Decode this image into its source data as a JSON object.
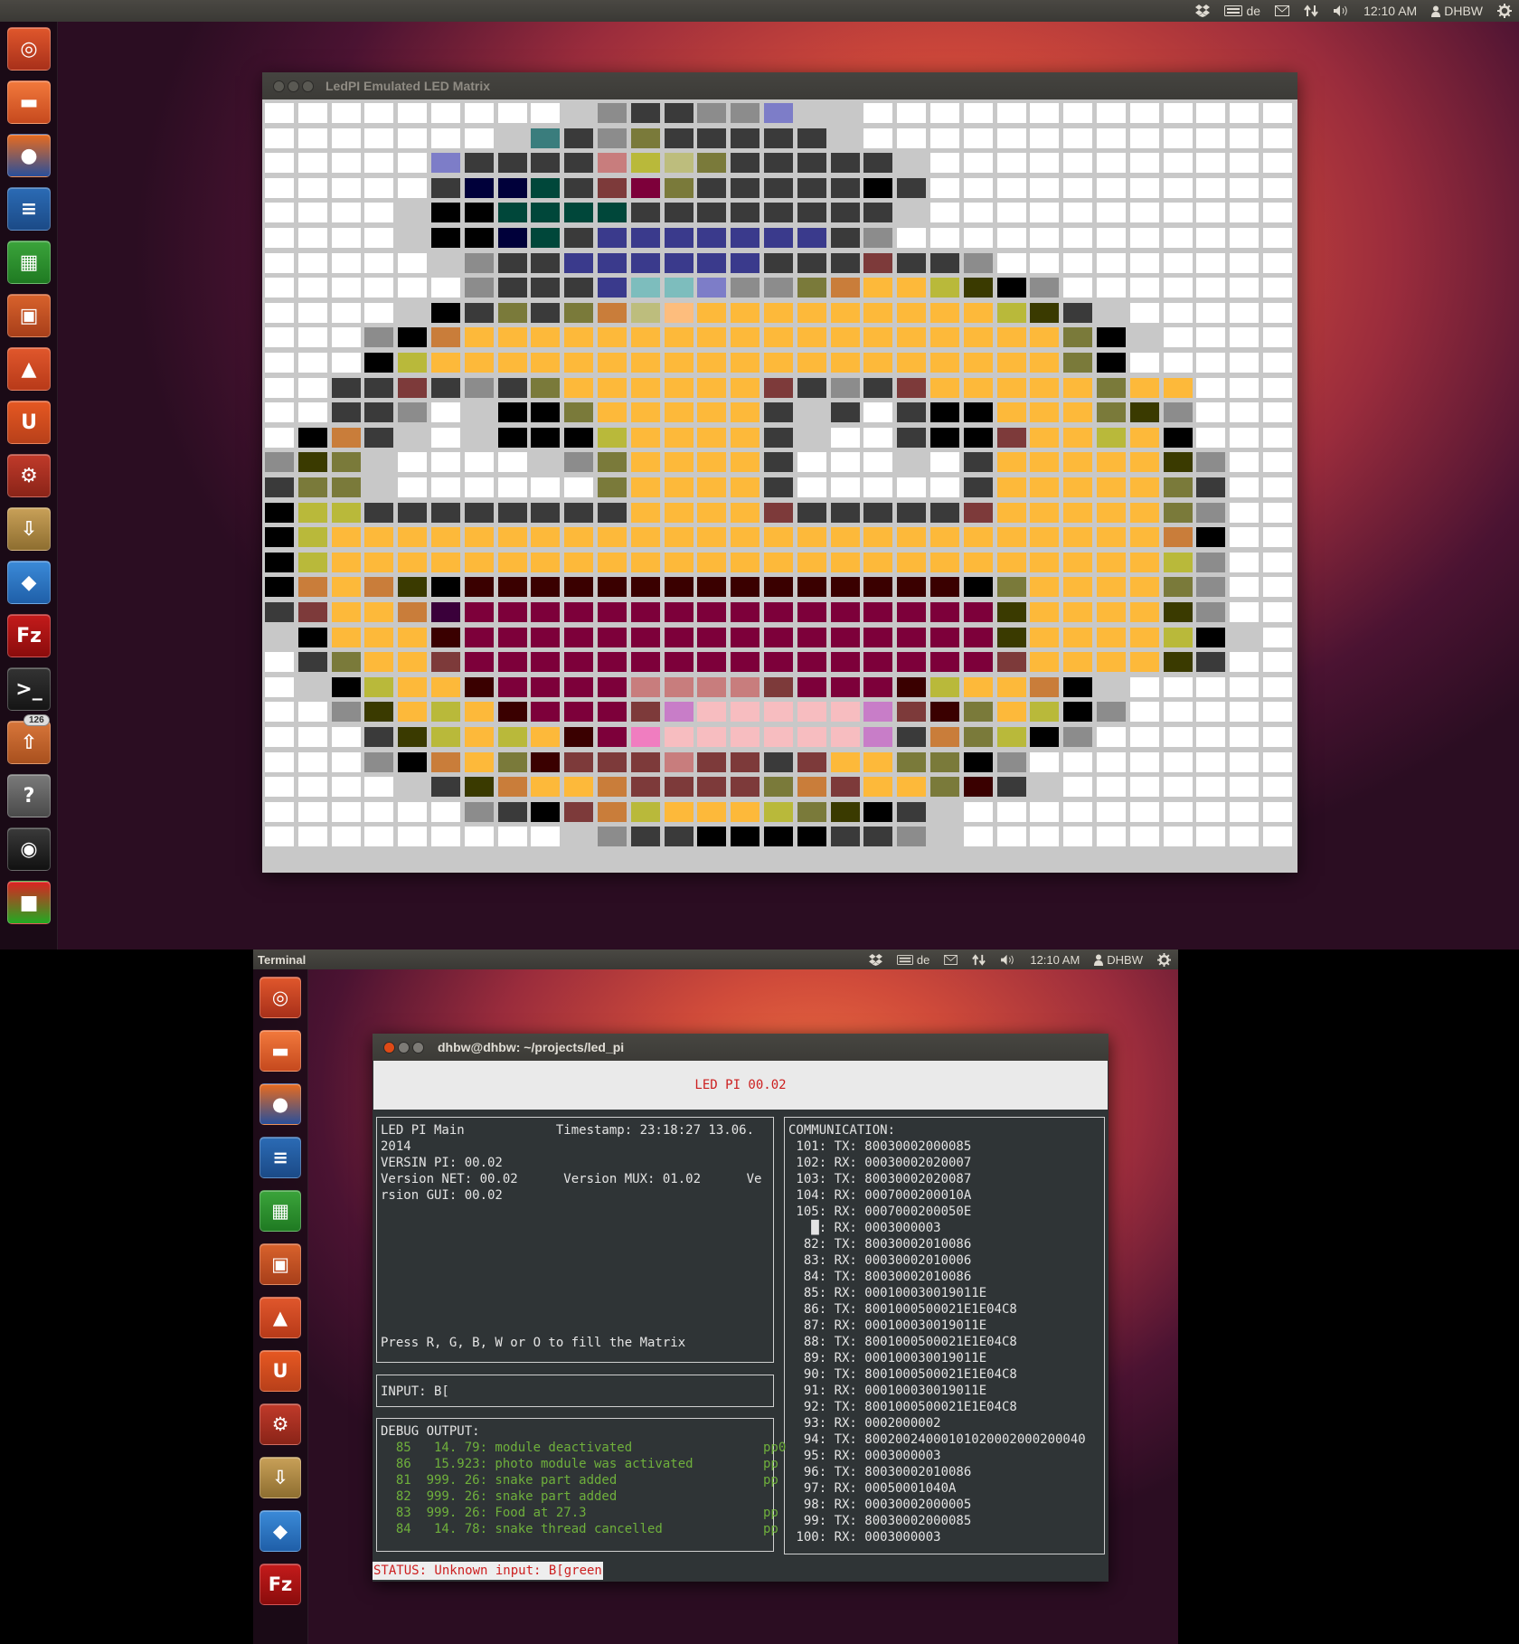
{
  "top_panel": {
    "keyboard_layout": "de",
    "clock": "12:10 AM",
    "user": "DHBW"
  },
  "second_panel": {
    "app_title": "Terminal",
    "keyboard_layout": "de",
    "clock": "12:10 AM",
    "user": "DHBW"
  },
  "launcher": {
    "items": [
      "ubuntu-home",
      "files",
      "firefox",
      "writer",
      "calc",
      "impress",
      "software-center",
      "ubuntu-one",
      "system-settings",
      "update-manager",
      "dropbox",
      "filezilla",
      "terminal",
      "archive-manager",
      "help",
      "webcam",
      "workspaces",
      "trash"
    ],
    "badge_count": "126"
  },
  "led_window": {
    "title": "LedPI Emulated LED Matrix",
    "palette": {
      "W": "#ffffff",
      "L": "#c8c8c8",
      "G": "#8c8c8c",
      "D": "#3a3a3a",
      "K": "#000000",
      "Y": "#fdb93a",
      "O": "#c97d3a",
      "V": "#7a7a3a",
      "A": "#b9b93a",
      "Q": "#3a3a00",
      "N": "#00003a",
      "B": "#3a3a8c",
      "P": "#7d7dc8",
      "T": "#00473a",
      "C": "#3a7d7d",
      "S": "#7dbdbd",
      "M": "#7d003a",
      "R": "#3a0000",
      "X": "#7d3a3a",
      "H": "#c87d7d",
      "F": "#f7bdc0",
      "I": "#c87dc8",
      "J": "#f07dc0",
      "E": "#bdbd7d",
      "U": "#3a003a",
      "Z": "#fdbd7d",
      "k": "#7d3a7d"
    },
    "rows": [
      "WWWWWWWWWLGDDGGPLLWWWWWWWWWWWWW",
      "WWWWWWWLCDGVDDDDDLWWWWWWWWWWWWW",
      "WWWWWPDDDDHAEVDDDDDLWWWWWWWWWWW",
      "WWWWWDNNTDXMVDDDDDKDWWWWWWWWWWW",
      "WWWWLKKTTTTDDDDDDDDLWWWWWWWWWWW",
      "WWWWLKKNTDBBBBBBBDGWWWWWWWWWWWW",
      "WWWWWLGDDBBBBBBDDDXDDGWWWWWWWWW",
      "WWWWWWGDDDBSSPGGVOYYAQKGWWWWWWW",
      "WWWWLKDVDVOEZYYYYYYYYYAQDLWWWWW",
      "WWWGKOYYYYYYYYYYYYYYYYYYVKLWWWW",
      "WWWKAYYYYYYYYYYYYYYYYYYYVKWWWWW",
      "WWDDXDGDVYYYYYYXDGDXYYYYYVYYWWW",
      "WWDDGWLKKVYYYYYDLDWDKKYYYVQGWWW",
      "WKODLWLKKKAYYYYDLWWDKKXYYAYKWWW",
      "GQVLWWWWLGVYYYYDWWWLWDYYYYYQGWW",
      "DVVLWWWWWWVYYYYDWWWWWDYYYYYVDWW",
      "KAADDDDDDDDYYYYXDDDDDXYYYYYVGWW",
      "KAYYYYYYYYYYYYYYYYYYYYYYYYYOKWW",
      "KAYYYYYYYYYYYYYYYYYYYYYYYYYAGWW",
      "KOYOQKRRRRRRRRRRRRRRRKVYYYYVGWW",
      "DXYYOUMMMMMMMMMMMMMMMMQYYYYQGWW",
      "LKYYYRMMMMMMMMMMMMMMMMQYYYYAKLW",
      "WDVYYXMMMMMMMMMMMMMMMMXYYYYQDWW",
      "WLKAYYRMMMMHHHHXMMMRAYYOKLWWWWW",
      "WWGQYAYRMMMXIFFFFFIXRVYAKGWWWWW",
      "WWWDQAYAYRMJFFFFFFIDOVAKGWWWWWW",
      "WWWGKOYVRXXXHXXDXYYVVKGWWWWWWWW",
      "WWWWLDQOYYOXXXXVOXYYVRDLWWWWWWW",
      "WWWWWWGDKXOAYYYAVQKDLWWWWWWWWWW",
      "WWWWWWWWWLGDDKKKKDDGLWWWWWWWWWW"
    ]
  },
  "terminal": {
    "title": "dhbw@dhbw: ~/projects/led_pi",
    "header": "LED PI 00.02",
    "main_lines": [
      "LED PI Main            Timestamp: 23:18:27 13.06.",
      "2014",
      "VERSIN PI: 00.02",
      "Version NET: 00.02      Version MUX: 01.02      Ve",
      "rsion GUI: 00.02"
    ],
    "prompt_text": "Press R, G, B, W or O to fill the Matrix",
    "input_label": "INPUT: B[",
    "debug_title": "DEBUG OUTPUT:",
    "debug_lines": [
      "  85   14. 79: module deactivated",
      "  86   15.923: photo module was activated",
      "  81  999. 26: snake part added",
      "  82  999. 26: snake part added",
      "  83  999. 26: Food at 27.3",
      "  84   14. 78: snake thread cancelled"
    ],
    "debug_suffix": [
      "pp0",
      "pp",
      "pp",
      "",
      "pp",
      "pp"
    ],
    "comm_title": "COMMUNICATION:",
    "comm_lines": [
      " 101: TX: 80030002000085",
      " 102: RX: 00030002020007",
      " 103: TX: 80030002020087",
      " 104: RX: 0007000200010A",
      " 105: RX: 0007000200050E",
      "   █: RX: 0003000003",
      "  82: TX: 80030002010086",
      "  83: RX: 00030002010006",
      "  84: TX: 80030002010086",
      "  85: RX: 000100030019011E",
      "  86: TX: 8001000500021E1E04C8",
      "  87: RX: 000100030019011E",
      "  88: TX: 8001000500021E1E04C8",
      "  89: RX: 000100030019011E",
      "  90: TX: 8001000500021E1E04C8",
      "  91: RX: 000100030019011E",
      "  92: TX: 8001000500021E1E04C8",
      "  93: RX: 0002000002",
      "  94: TX: 80020024000101020002000200040",
      "  95: RX: 0003000003",
      "  96: TX: 80030002010086",
      "  97: RX: 00050001040A",
      "  98: RX: 00030002000005",
      "  99: TX: 80030002000085",
      " 100: RX: 0003000003"
    ],
    "status": "STATUS:  Unknown input: B[green"
  }
}
